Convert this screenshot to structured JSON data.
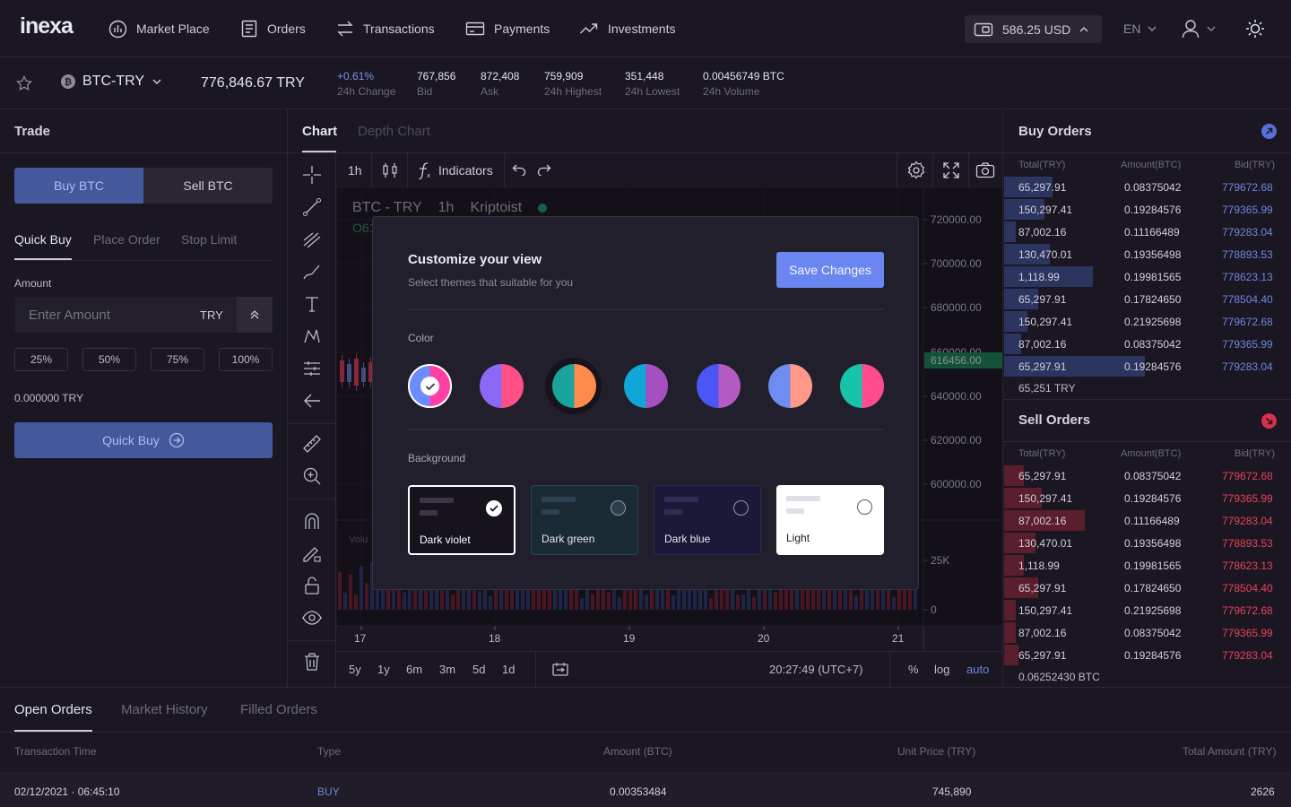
{
  "brand": {
    "logo": "inexa"
  },
  "nav": {
    "items": [
      {
        "label": "Market Place",
        "icon": "market-icon"
      },
      {
        "label": "Orders",
        "icon": "orders-icon"
      },
      {
        "label": "Transactions",
        "icon": "transactions-icon"
      },
      {
        "label": "Payments",
        "icon": "payments-icon"
      },
      {
        "label": "Investments",
        "icon": "investments-icon"
      }
    ],
    "balance": "586.25 USD",
    "language": "EN"
  },
  "ticker": {
    "pair": "BTC-TRY",
    "price": "776,846.67 TRY",
    "stats": [
      {
        "value": "+0.61%",
        "label": "24h Change"
      },
      {
        "value": "767,856",
        "label": "Bid"
      },
      {
        "value": "872,408",
        "label": "Ask"
      },
      {
        "value": "759,909",
        "label": "24h Highest"
      },
      {
        "value": "351,448",
        "label": "24h Lowest"
      },
      {
        "value": "0.00456749 BTC",
        "label": "24h Volume"
      }
    ]
  },
  "trade": {
    "title": "Trade",
    "buy_label": "Buy BTC",
    "sell_label": "Sell BTC",
    "tabs": [
      "Quick Buy",
      "Place Order",
      "Stop Limit"
    ],
    "amount_label": "Amount",
    "amount_placeholder": "Enter Amount",
    "currency": "TRY",
    "percents": [
      "25%",
      "50%",
      "75%",
      "100%"
    ],
    "total": "0.000000 TRY",
    "submit_label": "Quick Buy"
  },
  "chart": {
    "tabs": [
      "Chart",
      "Depth Chart"
    ],
    "interval": "1h",
    "indicators_label": "Indicators",
    "legend": {
      "pair": "BTC - TRY",
      "interval": "1h",
      "source": "Kriptoist",
      "partial": "O61"
    },
    "y_labels": [
      "720000.00",
      "700000.00",
      "680000.00",
      "660000.00",
      "640000.00",
      "620000.00",
      "600000.00"
    ],
    "current_price": "616456.00",
    "volume_label": "Volu",
    "vol_labels": [
      "25K",
      "0"
    ],
    "x_labels": [
      "17",
      "18",
      "19",
      "20",
      "21"
    ],
    "ranges": [
      "5y",
      "1y",
      "6m",
      "3m",
      "5d",
      "1d"
    ],
    "time": "20:27:49 (UTC+7)",
    "scale": [
      "%",
      "log",
      "auto"
    ]
  },
  "modal": {
    "title": "Customize your view",
    "subtitle": "Select themes that suitable for you",
    "save_label": "Save Changes",
    "color_label": "Color",
    "colors": [
      {
        "left": "#6b8cff",
        "right": "#ff3fa4"
      },
      {
        "left": "#8b68f5",
        "right": "#ff4f86"
      },
      {
        "left": "#1aa39a",
        "right": "#ff8a4c"
      },
      {
        "left": "#10a7d6",
        "right": "#a54fc0"
      },
      {
        "left": "#4a56f5",
        "right": "#b35bc3"
      },
      {
        "left": "#6f8cf0",
        "right": "#ff9a8a"
      },
      {
        "left": "#17c3a9",
        "right": "#ff4c8c"
      }
    ],
    "background_label": "Background",
    "backgrounds": [
      {
        "label": "Dark violet",
        "bg": "#1b1824",
        "selected": true
      },
      {
        "label": "Dark green",
        "bg": "#1b2b36",
        "selected": false
      },
      {
        "label": "Dark blue",
        "bg": "#1a1a38",
        "selected": false
      },
      {
        "label": "Light",
        "bg": "#ffffff",
        "selected": false
      }
    ]
  },
  "buy_orders": {
    "title": "Buy Orders",
    "headers": [
      "Total(TRY)",
      "Amount(BTC)",
      "Bid(TRY)"
    ],
    "rows": [
      {
        "total": "65,297.91",
        "amount": "0.08375042",
        "price": "779672.68",
        "depth": 0.17
      },
      {
        "total": "150,297.41",
        "amount": "0.19284576",
        "price": "779365.99",
        "depth": 0.14
      },
      {
        "total": "87,002.16",
        "amount": "0.11166489",
        "price": "779283.04",
        "depth": 0.04
      },
      {
        "total": "130,470.01",
        "amount": "0.19356498",
        "price": "778893.53",
        "depth": 0.16
      },
      {
        "total": "1,118.99",
        "amount": "0.19981565",
        "price": "778623.13",
        "depth": 0.31
      },
      {
        "total": "65,297.91",
        "amount": "0.17824650",
        "price": "778504.40",
        "depth": 0.12
      },
      {
        "total": "150,297.41",
        "amount": "0.21925698",
        "price": "779672.68",
        "depth": 0.08
      },
      {
        "total": "87,002.16",
        "amount": "0.08375042",
        "price": "779365.99",
        "depth": 0.06
      },
      {
        "total": "65,297.91",
        "amount": "0.19284576",
        "price": "779283.04",
        "depth": 0.49
      }
    ],
    "footer": "65,251 TRY"
  },
  "sell_orders": {
    "title": "Sell Orders",
    "headers": [
      "Total(TRY)",
      "Amount(BTC)",
      "Bid(TRY)"
    ],
    "rows": [
      {
        "total": "65,297.91",
        "amount": "0.08375042",
        "price": "779672.68",
        "depth": 0.07
      },
      {
        "total": "150,297.41",
        "amount": "0.19284576",
        "price": "779365.99",
        "depth": 0.13
      },
      {
        "total": "87,002.16",
        "amount": "0.11166489",
        "price": "779283.04",
        "depth": 0.28
      },
      {
        "total": "130,470.01",
        "amount": "0.19356498",
        "price": "778893.53",
        "depth": 0.11
      },
      {
        "total": "1,118.99",
        "amount": "0.19981565",
        "price": "778623.13",
        "depth": 0.07
      },
      {
        "total": "65,297.91",
        "amount": "0.17824650",
        "price": "778504.40",
        "depth": 0.12
      },
      {
        "total": "150,297.41",
        "amount": "0.21925698",
        "price": "779672.68",
        "depth": 0.04
      },
      {
        "total": "87,002.16",
        "amount": "0.08375042",
        "price": "779365.99",
        "depth": 0.04
      },
      {
        "total": "65,297.91",
        "amount": "0.19284576",
        "price": "779283.04",
        "depth": 0.05
      }
    ],
    "footer": "0.06252430 BTC"
  },
  "bottom": {
    "tabs": [
      "Open Orders",
      "Market History",
      "Filled Orders"
    ],
    "headers": [
      "Transaction Time",
      "Type",
      "Amount (BTC)",
      "Unit Price (TRY)",
      "Total Amount (TRY)"
    ],
    "rows": [
      {
        "time": "02/12/2021 · 06:45:10",
        "type": "BUY",
        "amount": "0.00353484",
        "price": "745,890",
        "total": "2626"
      }
    ]
  },
  "colors": {
    "accent": "#5b74d6",
    "buy": "#6f86e0",
    "sell": "#e8435a",
    "price_tag": "#1a8f5a"
  }
}
